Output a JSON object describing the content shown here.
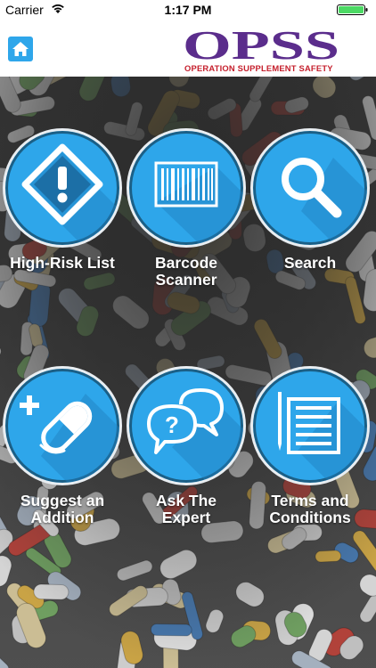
{
  "status_bar": {
    "carrier": "Carrier",
    "time": "1:17 PM"
  },
  "header": {
    "logo_text": "OPSS",
    "logo_tagline": "OPERATION SUPPLEMENT SAFETY"
  },
  "colors": {
    "accent": "#2ea6ea",
    "brand_purple": "#5b2d8c",
    "brand_red": "#c51f2c"
  },
  "menu": [
    {
      "label": "High-Risk List",
      "icon": "warning-icon"
    },
    {
      "label": "Barcode Scanner",
      "icon": "barcode-icon"
    },
    {
      "label": "Search",
      "icon": "search-icon"
    },
    {
      "label": "Suggest an Addition",
      "icon": "add-pill-icon"
    },
    {
      "label": "Ask The Expert",
      "icon": "chat-question-icon"
    },
    {
      "label": "Terms and Conditions",
      "icon": "document-icon"
    }
  ]
}
